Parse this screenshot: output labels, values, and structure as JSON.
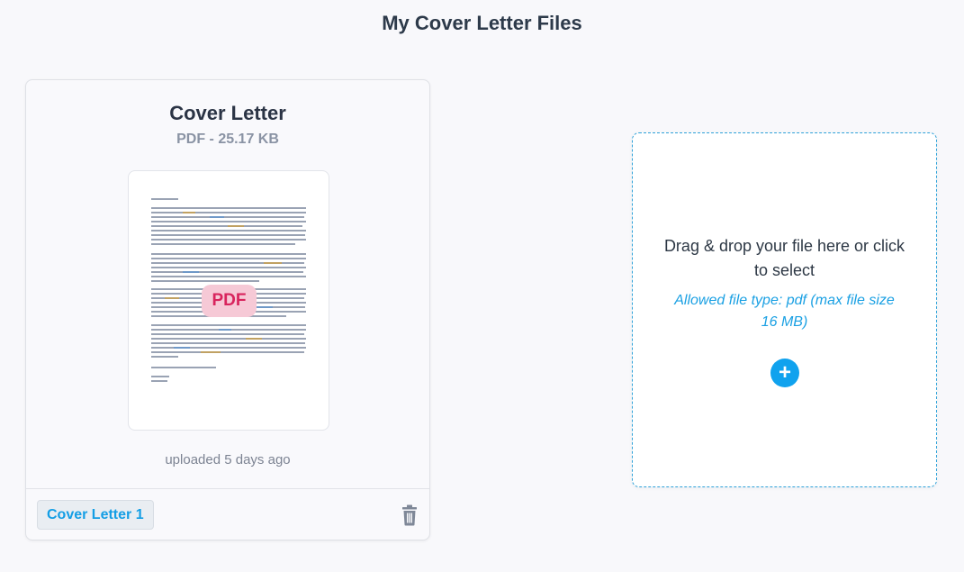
{
  "page": {
    "title": "My Cover Letter Files"
  },
  "file_card": {
    "title": "Cover Letter",
    "meta": "PDF - 25.17 KB",
    "badge": "PDF",
    "uploaded": "uploaded 5 days ago",
    "file_label": "Cover Letter 1",
    "delete_icon": "trash-icon"
  },
  "dropzone": {
    "prompt": "Drag & drop your file here or click to select",
    "hint": "Allowed file type: pdf (max file size 16 MB)",
    "add_icon": "plus-icon"
  },
  "colors": {
    "accent": "#10a2ee",
    "badge_bg": "#f6c9d6",
    "badge_text": "#d8245d",
    "dropzone_border": "#2fa2d9"
  }
}
